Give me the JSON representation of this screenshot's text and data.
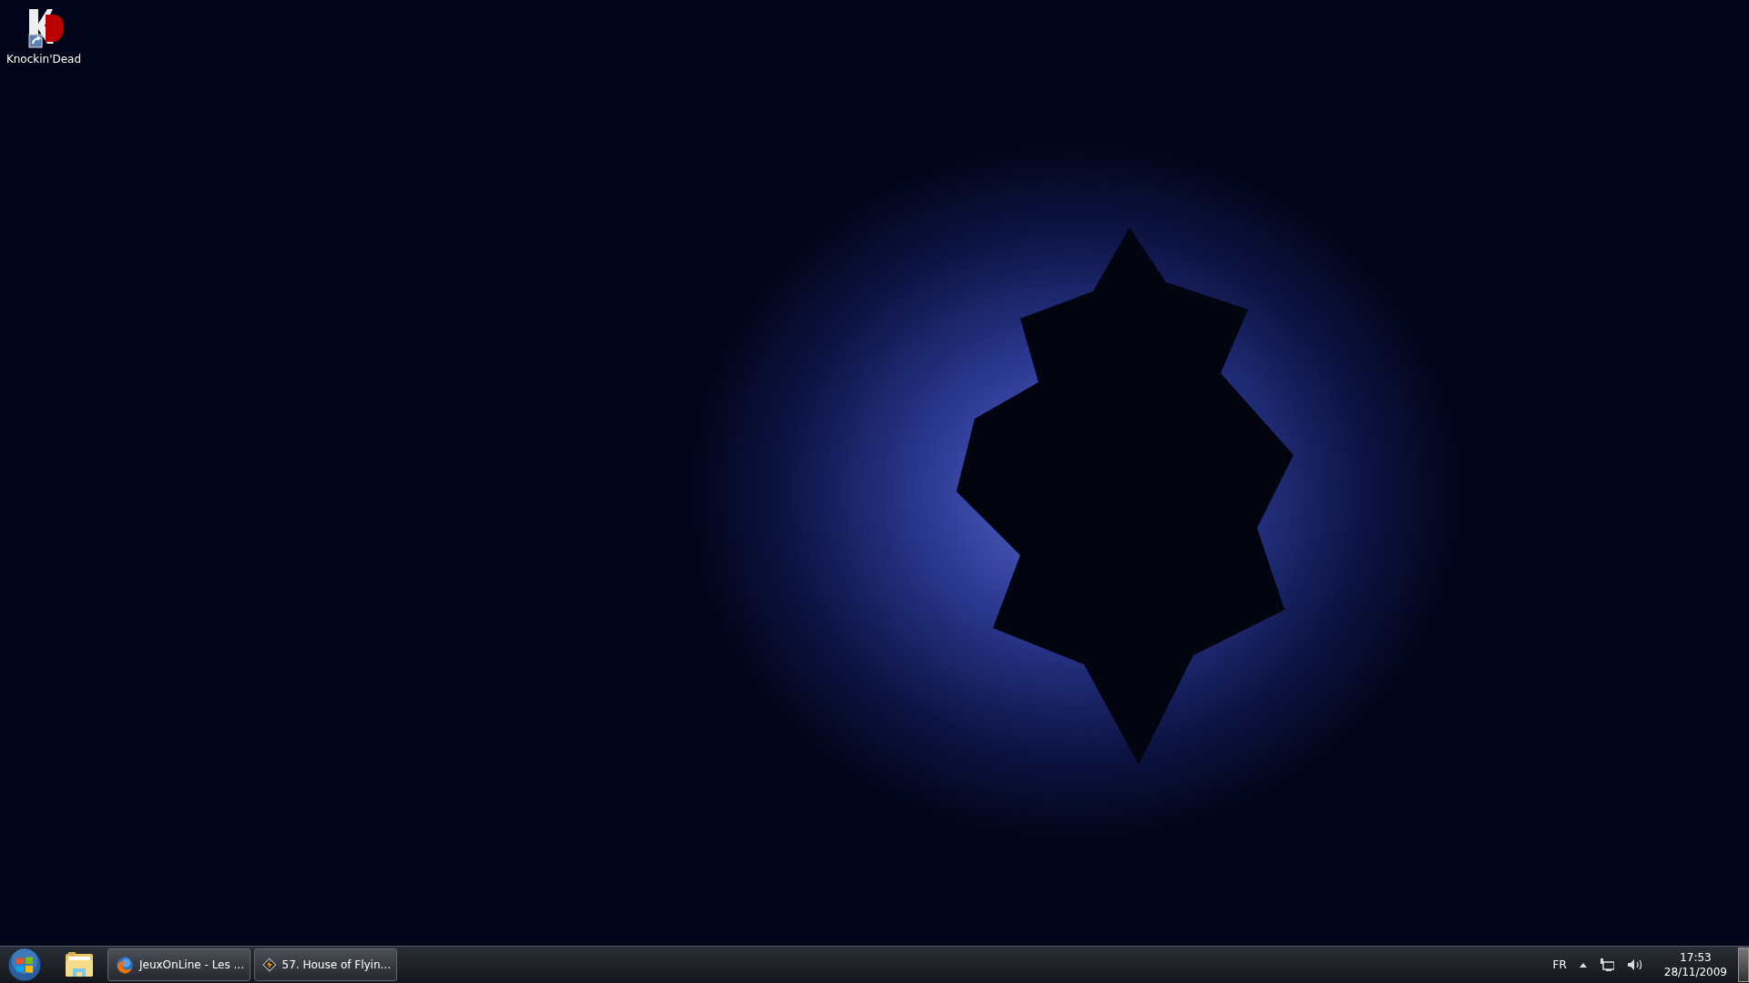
{
  "desktop_icons": [
    {
      "label": "Knockin'Dead"
    }
  ],
  "taskbar": {
    "pinned": [
      {
        "kind": "start"
      },
      {
        "kind": "explorer"
      }
    ],
    "windows": [
      {
        "kind": "firefox",
        "label": "JeuxOnLine - Les ..."
      },
      {
        "kind": "winamp",
        "label": "57. House of Flyin..."
      }
    ],
    "tray": {
      "language": "FR",
      "time": "17:53",
      "date": "28/11/2009"
    }
  }
}
